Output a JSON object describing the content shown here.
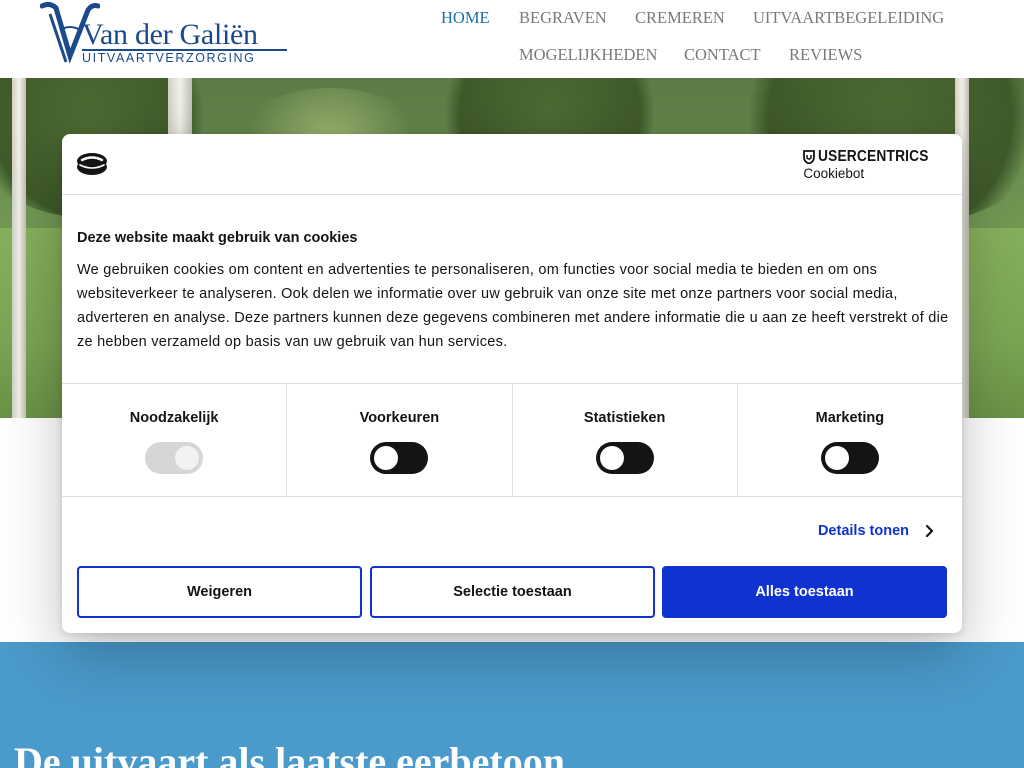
{
  "header": {
    "logo": {
      "name": "Van der Galiën",
      "subtitle": "UITVAARTVERZORGING"
    },
    "nav": [
      {
        "label": "HOME",
        "active": true
      },
      {
        "label": "BEGRAVEN",
        "active": false
      },
      {
        "label": "CREMEREN",
        "active": false
      },
      {
        "label": "UITVAARTBEGELEIDING",
        "active": false
      },
      {
        "label": "MOGELIJKHEDEN",
        "active": false
      },
      {
        "label": "CONTACT",
        "active": false
      },
      {
        "label": "REVIEWS",
        "active": false
      }
    ]
  },
  "hero": {
    "heading": "De uitvaart als laatste eerbetoon"
  },
  "cookie_dialog": {
    "brand": {
      "name": "USERCENTRICS",
      "product": "Cookiebot"
    },
    "title": "Deze website maakt gebruik van cookies",
    "body": "We gebruiken cookies om content en advertenties te personaliseren, om functies voor social media te bieden en om ons websiteverkeer te analyseren. Ook delen we informatie over uw gebruik van onze site met onze partners voor social media, adverteren en analyse. Deze partners kunnen deze gegevens combineren met andere informatie die u aan ze heeft verstrekt of die ze hebben verzameld op basis van uw gebruik van hun services.",
    "categories": [
      {
        "label": "Noodzakelijk",
        "enabled": true,
        "locked": true
      },
      {
        "label": "Voorkeuren",
        "enabled": false,
        "locked": false
      },
      {
        "label": "Statistieken",
        "enabled": false,
        "locked": false
      },
      {
        "label": "Marketing",
        "enabled": false,
        "locked": false
      }
    ],
    "details_link": "Details tonen",
    "buttons": {
      "deny": "Weigeren",
      "allow_selection": "Selectie toestaan",
      "allow_all": "Alles toestaan"
    }
  },
  "colors": {
    "brand_blue": "#1a4a8c",
    "nav_active": "#1d6fa5",
    "nav_default": "#7a7a7a",
    "cookie_accent": "#1032cf",
    "band_blue": "#4a9acb"
  }
}
